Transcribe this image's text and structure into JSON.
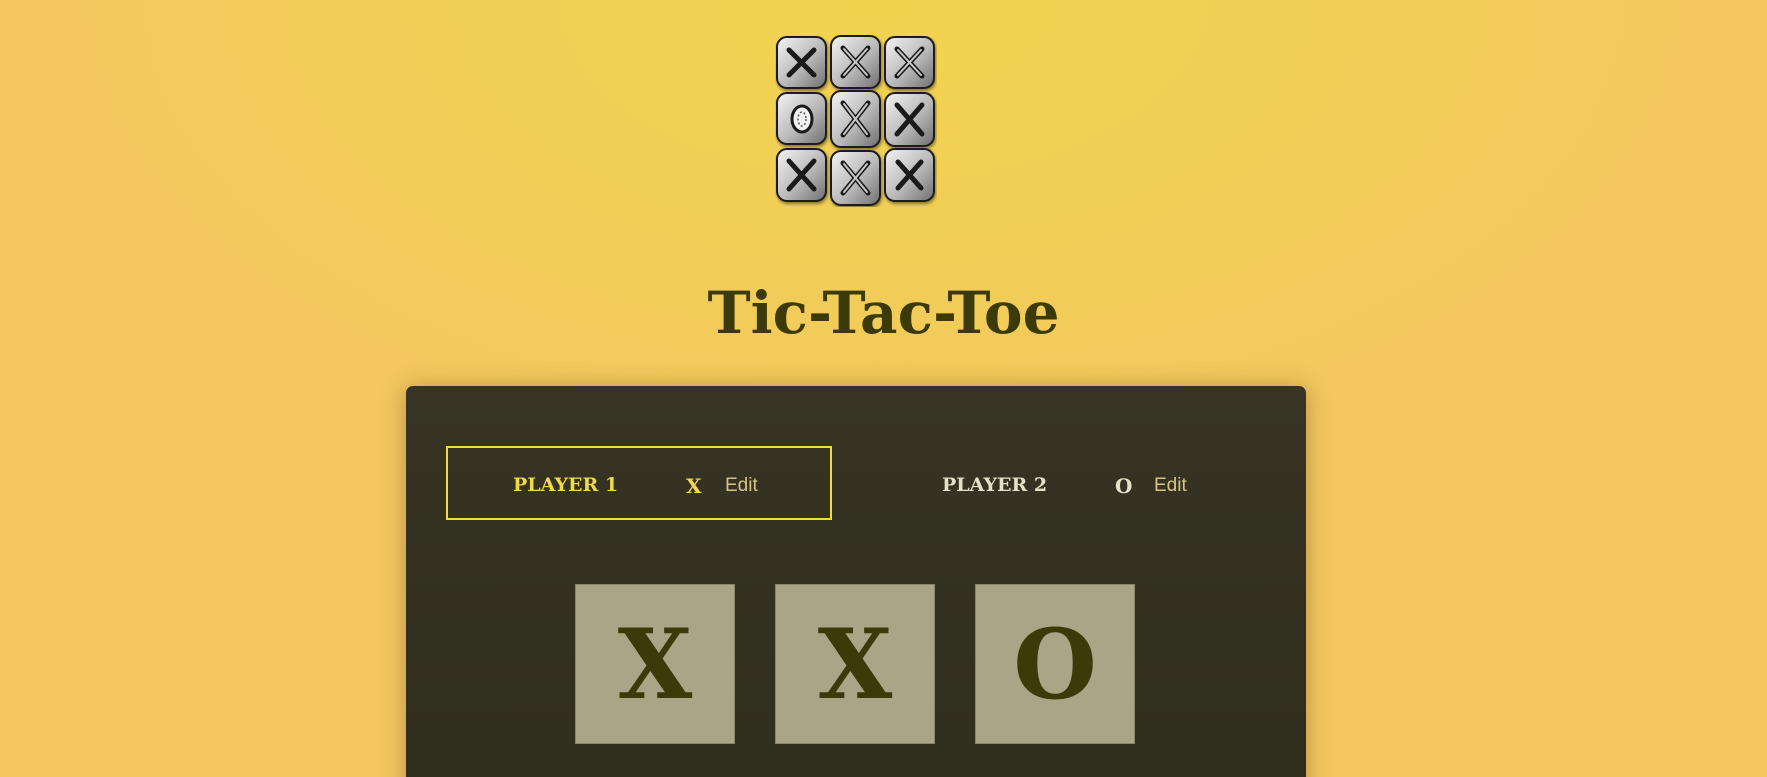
{
  "header": {
    "title": "Tic-Tac-Toe",
    "logo_icon": "tic-tac-toe-board-logo"
  },
  "players": [
    {
      "name": "PLAYER 1",
      "symbol": "X",
      "edit_label": "Edit",
      "active": true
    },
    {
      "name": "PLAYER 2",
      "symbol": "O",
      "edit_label": "Edit",
      "active": false
    }
  ],
  "board": {
    "visible_row": [
      "X",
      "X",
      "O"
    ]
  },
  "colors": {
    "background": "#f2d34f",
    "panel": "#33311f",
    "active_accent": "#f2d94a",
    "cell": "#aaa587",
    "mark": "#3b3a08"
  }
}
